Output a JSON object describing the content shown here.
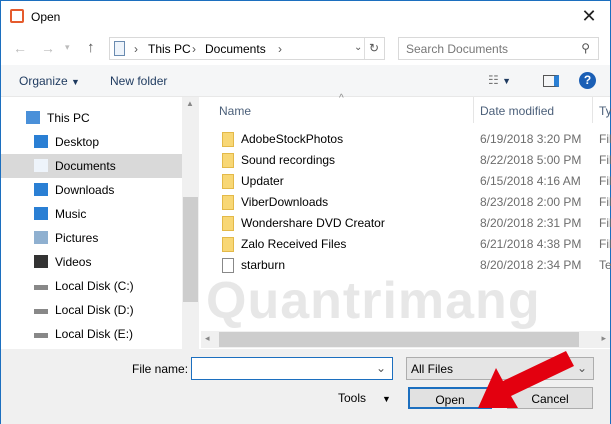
{
  "window": {
    "title": "Open",
    "close": "✕"
  },
  "nav": {
    "breadcrumb": [
      "This PC",
      "Documents"
    ],
    "search_placeholder": "Search Documents"
  },
  "toolbar": {
    "organize": "Organize",
    "new_folder": "New folder",
    "help": "?"
  },
  "sidebar": {
    "items": [
      {
        "label": "This PC",
        "icon": "computer-icon"
      },
      {
        "label": "Desktop",
        "icon": "desktop-icon"
      },
      {
        "label": "Documents",
        "icon": "documents-icon",
        "selected": true
      },
      {
        "label": "Downloads",
        "icon": "downloads-icon"
      },
      {
        "label": "Music",
        "icon": "music-icon"
      },
      {
        "label": "Pictures",
        "icon": "pictures-icon"
      },
      {
        "label": "Videos",
        "icon": "videos-icon"
      },
      {
        "label": "Local Disk (C:)",
        "icon": "drive-icon"
      },
      {
        "label": "Local Disk (D:)",
        "icon": "drive-icon"
      },
      {
        "label": "Local Disk (E:)",
        "icon": "drive-icon"
      }
    ]
  },
  "list": {
    "columns": {
      "name": "Name",
      "date": "Date modified",
      "type": "Ty"
    },
    "rows": [
      {
        "name": "AdobeStockPhotos",
        "date": "6/19/2018 3:20 PM",
        "type": "Fil",
        "kind": "folder"
      },
      {
        "name": "Sound recordings",
        "date": "8/22/2018 5:00 PM",
        "type": "Fil",
        "kind": "folder"
      },
      {
        "name": "Updater",
        "date": "6/15/2018 4:16 AM",
        "type": "Fil",
        "kind": "folder"
      },
      {
        "name": "ViberDownloads",
        "date": "8/23/2018 2:00 PM",
        "type": "Fil",
        "kind": "folder"
      },
      {
        "name": "Wondershare DVD Creator",
        "date": "8/20/2018 2:31 PM",
        "type": "Fil",
        "kind": "folder"
      },
      {
        "name": "Zalo Received Files",
        "date": "6/21/2018 4:38 PM",
        "type": "Fil",
        "kind": "folder"
      },
      {
        "name": "starburn",
        "date": "8/20/2018 2:34 PM",
        "type": "Te",
        "kind": "file"
      }
    ]
  },
  "bottom": {
    "file_name_label": "File name:",
    "file_name_value": "",
    "file_type": "All Files",
    "tools": "Tools",
    "open": "Open",
    "cancel": "Cancel"
  },
  "watermark": "Quantrimang"
}
